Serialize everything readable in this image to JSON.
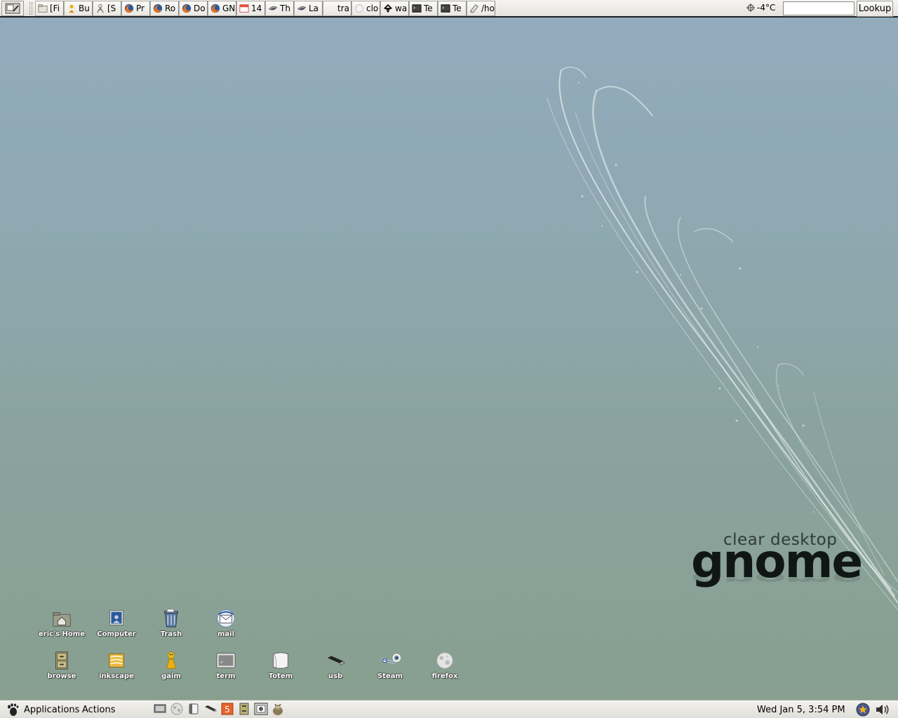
{
  "top_panel": {
    "tasks": [
      {
        "label": "[Fi",
        "icon": "folder-icon"
      },
      {
        "label": "Bu",
        "icon": "gaim-buddy-icon"
      },
      {
        "label": "[S",
        "icon": "gaim-person-icon"
      },
      {
        "label": "Pr",
        "icon": "firefox-icon"
      },
      {
        "label": "Ro",
        "icon": "firefox-icon"
      },
      {
        "label": "Do",
        "icon": "firefox-icon"
      },
      {
        "label": "GN",
        "icon": "firefox-icon"
      },
      {
        "label": "14",
        "icon": "calendar-icon"
      },
      {
        "label": "Th",
        "icon": "epiphany-icon"
      },
      {
        "label": "La",
        "icon": "epiphany-icon"
      },
      {
        "label": "tra",
        "icon": "blank-icon"
      },
      {
        "label": "clo",
        "icon": "clock-icon"
      },
      {
        "label": "wa",
        "icon": "inkscape-icon"
      },
      {
        "label": "Te",
        "icon": "terminal-icon"
      },
      {
        "label": "Te",
        "icon": "terminal-icon"
      },
      {
        "label": "/ho",
        "icon": "text-editor-icon"
      }
    ],
    "weather": "-4°C",
    "dictionary_value": "",
    "lookup_label": "Lookup"
  },
  "desktop": {
    "icons_row1": [
      {
        "label": "eric's Home",
        "icon": "home-folder-icon"
      },
      {
        "label": "Computer",
        "icon": "computer-icon"
      },
      {
        "label": "Trash",
        "icon": "trash-icon"
      },
      {
        "label": "mail",
        "icon": "mail-icon"
      }
    ],
    "icons_row2": [
      {
        "label": "browse",
        "icon": "file-cabinet-icon"
      },
      {
        "label": "inkscape",
        "icon": "inkscape-doc-icon"
      },
      {
        "label": "gaim",
        "icon": "gaim-icon"
      },
      {
        "label": "term",
        "icon": "terminal-icon"
      },
      {
        "label": "Totem",
        "icon": "totem-icon"
      },
      {
        "label": "usb",
        "icon": "usb-drive-icon"
      },
      {
        "label": "Steam",
        "icon": "steam-icon"
      },
      {
        "label": "firefox",
        "icon": "firefox-icon"
      }
    ],
    "brand_sub": "clear desktop",
    "brand_main": "gnome"
  },
  "bottom_panel": {
    "applications_label": "Applications",
    "actions_label": "Actions",
    "clock": "Wed Jan  5,  3:54 PM"
  },
  "colors": {
    "desktop_top": "#93abbe",
    "desktop_bottom": "#889f8e",
    "panel": "#eeede9"
  }
}
